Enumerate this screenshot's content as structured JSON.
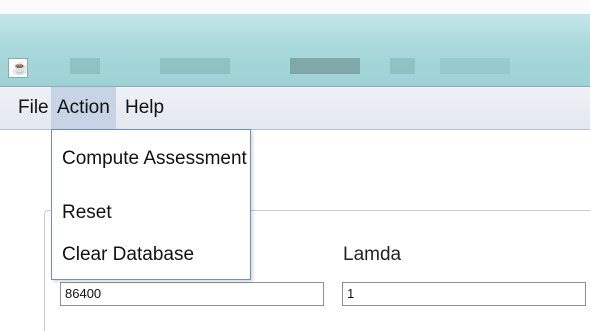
{
  "menubar": {
    "items": [
      {
        "label": "File"
      },
      {
        "label": "Action"
      },
      {
        "label": "Help"
      }
    ]
  },
  "action_menu": {
    "items": [
      {
        "label": "Compute Assessment"
      },
      {
        "label": "Reset"
      },
      {
        "label": "Clear Database"
      }
    ]
  },
  "form": {
    "lamda_label": "Lamda",
    "left_field_value": "86400",
    "lamda_field_value": "1"
  },
  "icons": {
    "app": "java-coffee-icon"
  },
  "colors": {
    "titlebar": "#a9d9dc",
    "menubar": "#e3e8ef",
    "active_menu": "#c8d4e6",
    "dropdown_border": "#6d8fbf"
  }
}
